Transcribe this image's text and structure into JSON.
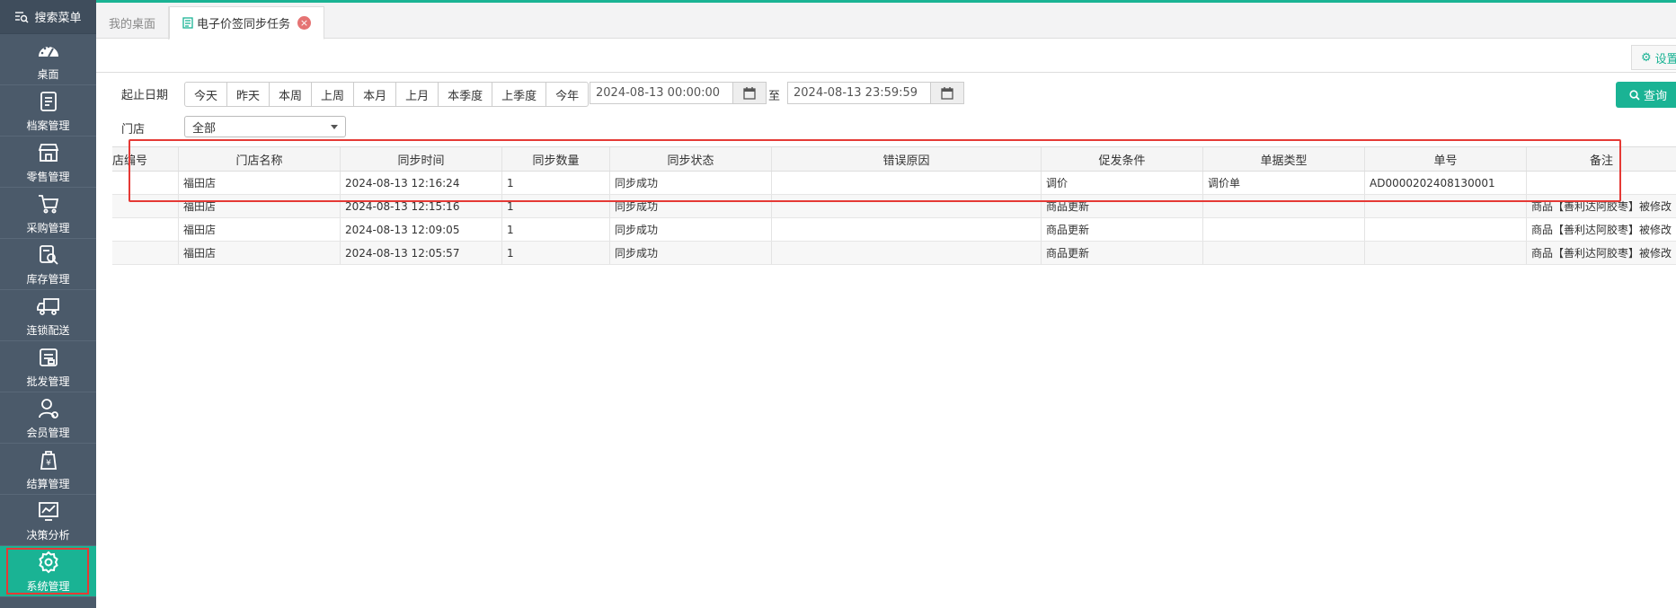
{
  "sidebar": {
    "search_label": "搜索菜单",
    "items": [
      {
        "label": "桌面",
        "icon": "dashboard-icon"
      },
      {
        "label": "档案管理",
        "icon": "archive-icon"
      },
      {
        "label": "零售管理",
        "icon": "store-icon"
      },
      {
        "label": "采购管理",
        "icon": "cart-icon"
      },
      {
        "label": "库存管理",
        "icon": "inventory-icon"
      },
      {
        "label": "连锁配送",
        "icon": "truck-icon"
      },
      {
        "label": "批发管理",
        "icon": "wholesale-icon"
      },
      {
        "label": "会员管理",
        "icon": "member-icon"
      },
      {
        "label": "结算管理",
        "icon": "settlement-icon"
      },
      {
        "label": "决策分析",
        "icon": "chart-icon"
      },
      {
        "label": "系统管理",
        "icon": "gear-icon",
        "active": true
      }
    ]
  },
  "tabs": {
    "desk": "我的桌面",
    "active": "电子价签同步任务"
  },
  "toolbar": {
    "settings_label": "设置"
  },
  "filters": {
    "date_label": "起止日期",
    "ranges": [
      "今天",
      "昨天",
      "本周",
      "上周",
      "本月",
      "上月",
      "本季度",
      "上季度",
      "今年"
    ],
    "start_date": "2024-08-13 00:00:00",
    "to_label": "至",
    "end_date": "2024-08-13 23:59:59",
    "query_label": "查询",
    "store_label": "门店",
    "store_value": "全部"
  },
  "table": {
    "headers": [
      "店编号",
      "门店名称",
      "同步时间",
      "同步数量",
      "同步状态",
      "错误原因",
      "促发条件",
      "单据类型",
      "单号",
      "备注"
    ],
    "rows": [
      [
        "",
        "福田店",
        "2024-08-13 12:16:24",
        "1",
        "同步成功",
        "",
        "调价",
        "调价单",
        "AD0000202408130001",
        ""
      ],
      [
        "",
        "福田店",
        "2024-08-13 12:15:16",
        "1",
        "同步成功",
        "",
        "商品更新",
        "",
        "",
        "商品【善利达阿胶枣】被修改"
      ],
      [
        "",
        "福田店",
        "2024-08-13 12:09:05",
        "1",
        "同步成功",
        "",
        "商品更新",
        "",
        "",
        "商品【善利达阿胶枣】被修改"
      ],
      [
        "",
        "福田店",
        "2024-08-13 12:05:57",
        "1",
        "同步成功",
        "",
        "商品更新",
        "",
        "",
        "商品【善利达阿胶枣】被修改"
      ]
    ]
  },
  "colors": {
    "accent": "#1ab394",
    "sidebar": "#4b5a6a",
    "highlight": "#e53935"
  }
}
